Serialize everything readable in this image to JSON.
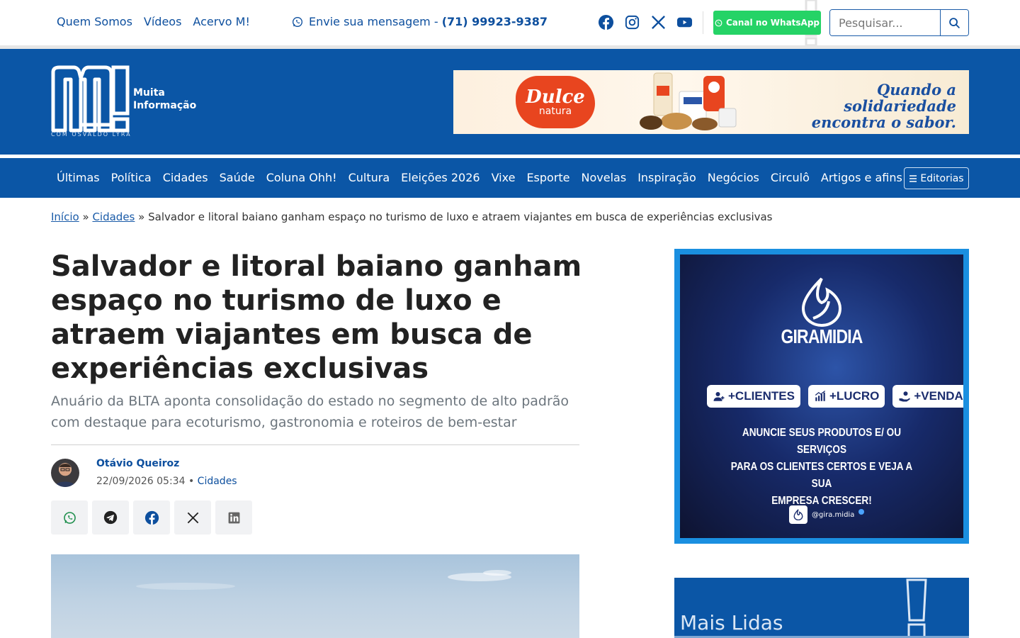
{
  "topbar": {
    "links": [
      "Quem Somos",
      "Vídeos",
      "Acervo M!"
    ],
    "contact_prefix": "Envie sua mensagem - ",
    "contact_phone": "(71) 99923-9387",
    "whatsapp_channel": "Canal no WhatsApp",
    "search_placeholder": "Pesquisar..."
  },
  "header": {
    "logo_line1": "Muita",
    "logo_line2": "Informação",
    "logo_tagline": "COM OSVALDO LYRA"
  },
  "banner": {
    "brand_line1": "Dulce",
    "brand_line2": "natura",
    "slogan_line1": "Quando a solidariedade",
    "slogan_line2": "encontra o sabor."
  },
  "nav": {
    "items": [
      "Últimas",
      "Política",
      "Cidades",
      "Saúde",
      "Coluna Ohh!",
      "Cultura",
      "Eleições 2026",
      "Vixe",
      "Esporte",
      "Novelas",
      "Inspiração",
      "Negócios",
      "Circulô",
      "Artigos e afins"
    ],
    "editorias": "Editorias"
  },
  "breadcrumb": {
    "home": "Início",
    "sep": "»",
    "section": "Cidades",
    "current": "Salvador e litoral baiano ganham espaço no turismo de luxo e atraem viajantes em busca de experiências exclusivas"
  },
  "article": {
    "title": "Salvador e litoral baiano ganham espaço no turismo de luxo e atraem viajantes em busca de experiências exclusivas",
    "subtitle": "Anuário da BLTA aponta consolidação do estado no segmento de alto padrão com destaque para ecoturismo, gastronomia e roteiros de bem-estar",
    "author": "Otávio Queiroz",
    "date": "22/09/2026 05:34",
    "meta_sep": "•",
    "category": "Cidades"
  },
  "ad": {
    "brand": "GIRAMIDIA",
    "pills": [
      "+CLIENTES",
      "+LUCRO",
      "+VENDAS"
    ],
    "copy_line1": "ANUNCIE SEUS PRODUTOS E/ OU SERVIÇOS",
    "copy_line2": "PARA OS CLIENTES CERTOS E VEJA A SUA",
    "copy_line3": "EMPRESA CRESCER!",
    "handle": "@gira.midia"
  },
  "sidebar": {
    "mais_lidas": "Mais Lidas"
  },
  "colors": {
    "brand_blue": "#0b56a6",
    "link_blue": "#0d4f9e",
    "whatsapp_green": "#25d366",
    "ad_border": "#1a8fe0"
  },
  "icons": [
    "whatsapp-icon",
    "facebook-icon",
    "instagram-icon",
    "x-icon",
    "youtube-icon",
    "search-icon",
    "menu-icon",
    "telegram-icon",
    "linkedin-icon"
  ]
}
